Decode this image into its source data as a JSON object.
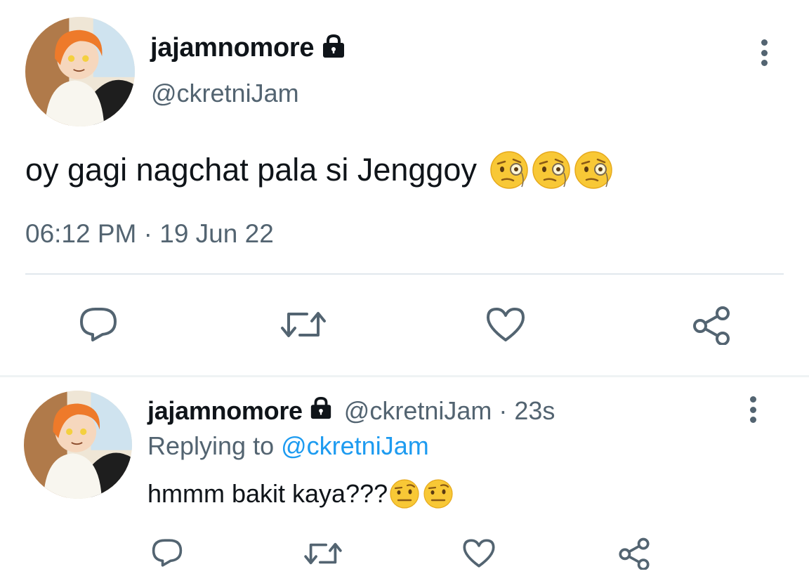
{
  "main_tweet": {
    "display_name": "jajamnomore",
    "handle": "@ckretniJam",
    "text": "oy gagi nagchat pala si Jenggoy",
    "emojis": [
      "face-with-monocle-emoji",
      "face-with-monocle-emoji",
      "face-with-monocle-emoji"
    ],
    "timestamp": "06:12 PM · 19 Jun 22"
  },
  "reply_tweet": {
    "display_name": "jajamnomore",
    "handle": "@ckretniJam",
    "separator": "·",
    "age": "23s",
    "replying_prefix": "Replying to",
    "replying_to": "@ckretniJam",
    "text": "hmmm bakit kaya???",
    "emojis": [
      "face-with-raised-eyebrow-emoji",
      "face-with-raised-eyebrow-emoji"
    ]
  },
  "actions": [
    "reply-icon",
    "retweet-icon",
    "like-icon",
    "share-icon"
  ],
  "colors": {
    "text": "#0f1419",
    "muted": "#536471",
    "link": "#1d9bf0",
    "divider": "#e1e8ed"
  }
}
